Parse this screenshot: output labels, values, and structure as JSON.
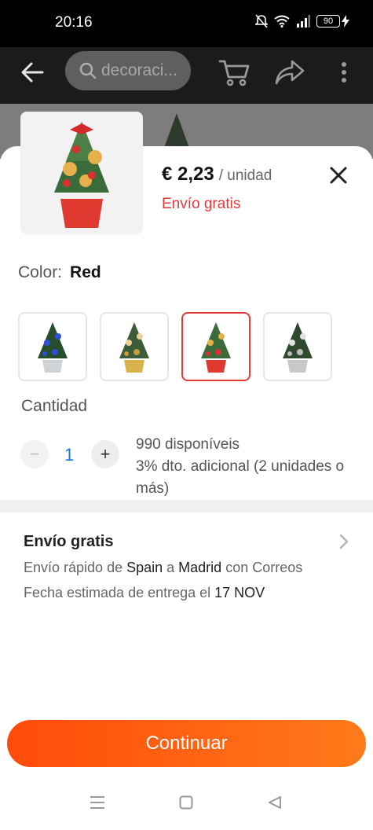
{
  "status_bar": {
    "time": "20:16",
    "battery": "90",
    "icons": [
      "mute-icon",
      "wifi-icon",
      "signal-icon",
      "battery-icon",
      "charging-icon"
    ]
  },
  "header": {
    "search_placeholder": "decoraci...",
    "icons": [
      "back-arrow-icon",
      "search-icon",
      "cart-icon",
      "share-icon",
      "more-vert-icon"
    ]
  },
  "product": {
    "price": "€ 2,23",
    "unit": "/ unidad",
    "shipping_badge": "Envío gratis"
  },
  "color": {
    "label": "Color:",
    "selected": "Red",
    "variants": [
      "Blue",
      "Gold",
      "Red",
      "Silver"
    ],
    "selected_index": 2
  },
  "quantity": {
    "label": "Cantidad",
    "value": "1",
    "minus": "−",
    "plus": "+",
    "available": "990 disponíveis",
    "discount": "3% dto. adicional (2 unidades o más)"
  },
  "shipping": {
    "title": "Envío gratis",
    "line1_prefix": "Envío rápido de ",
    "origin": "Spain",
    "line1_mid": " a ",
    "destination": "Madrid",
    "line1_suffix": " con Correos",
    "line2_prefix": "Fecha estimada de entrega el ",
    "date": "17 NOV"
  },
  "actions": {
    "continue_label": "Continuar"
  },
  "colors": {
    "accent": "#ff5a10",
    "price_red": "#e4393c",
    "qty_blue": "#1976d2"
  }
}
